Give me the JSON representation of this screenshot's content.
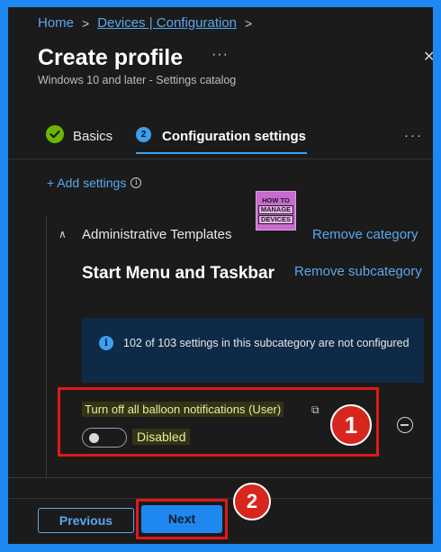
{
  "breadcrumb": {
    "home": "Home",
    "devices": "Devices | Configuration",
    "separator": ">"
  },
  "header": {
    "title": "Create profile",
    "menu_glyph": "···",
    "close_glyph": "✕",
    "subtitle": "Windows 10 and later - Settings catalog"
  },
  "steps": [
    {
      "label": "Basics",
      "state": "complete",
      "badge": "✓"
    },
    {
      "label": "Configuration settings",
      "state": "current",
      "number": "2"
    }
  ],
  "steps_menu_glyph": "···",
  "add_settings": {
    "label": "+ Add settings",
    "info_glyph": "i"
  },
  "watermark_logo": {
    "line1": "HOW TO",
    "line2": "MANAGE",
    "line3": "DEVICES"
  },
  "category": {
    "chevron_glyph": "∧",
    "label": "Administrative Templates",
    "remove_label": "Remove category",
    "subcategory": {
      "title": "Start Menu and Taskbar",
      "remove_label": "Remove subcategory"
    }
  },
  "info_bar": {
    "icon_glyph": "i",
    "text": "102 of 103 settings in this subcategory are not configured"
  },
  "setting": {
    "label": "Turn off all balloon notifications (User)",
    "toggle_state": "Disabled",
    "copy_glyph": "⧉"
  },
  "annotations": {
    "badge1": "1",
    "badge2": "2"
  },
  "footer": {
    "previous_label": "Previous",
    "next_label": "Next"
  },
  "colors": {
    "background": "#1b1b1b",
    "frame": "#1e88f0",
    "link": "#5aa7f0",
    "accent": "#3d9ff0",
    "success": "#6bb700",
    "annotation_red": "#e01919"
  }
}
